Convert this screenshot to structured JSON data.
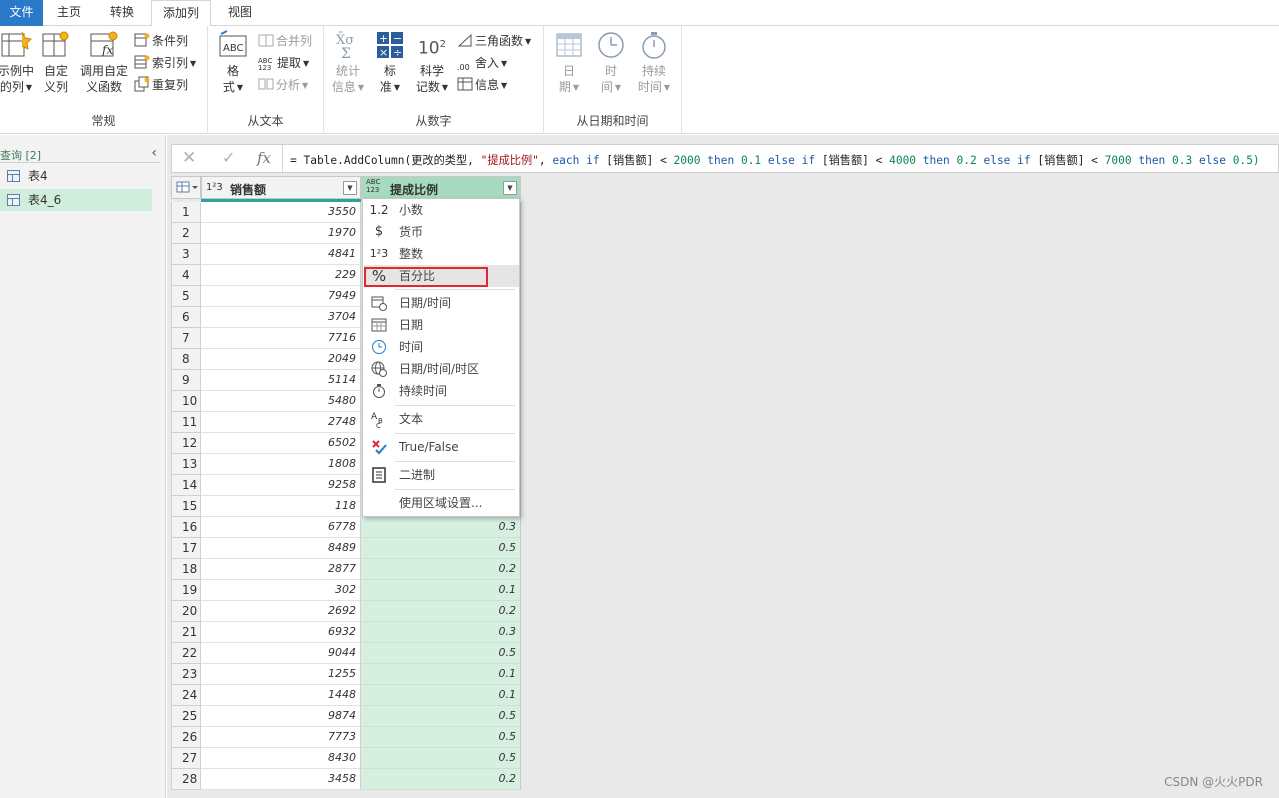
{
  "tabs": [
    {
      "label": "文件"
    },
    {
      "label": "主页"
    },
    {
      "label": "转换"
    },
    {
      "label": "添加列"
    },
    {
      "label": "视图"
    }
  ],
  "ribbon": {
    "general": {
      "label": "常规",
      "example_col_line1": "示例中",
      "example_col_line2": "的列",
      "custom_col_line1": "自定",
      "custom_col_line2": "义列",
      "invoke_func_line1": "调用自定",
      "invoke_func_line2": "义函数",
      "conditional_col": "条件列",
      "index_col": "索引列",
      "duplicate_col": "重复列"
    },
    "from_text": {
      "label": "从文本",
      "format_line1": "格",
      "format_line2": "式",
      "merge_cols": "合并列",
      "extract": "提取",
      "parse": "分析",
      "abc_icon_text": "ABC",
      "num_icon_text": "123"
    },
    "from_number": {
      "label": "从数字",
      "stats_line1": "统计",
      "stats_line2": "信息",
      "standard_line1": "标",
      "standard_line2": "准",
      "scientific_line1": "科学",
      "scientific_line2": "记数",
      "trig": "三角函数",
      "rounding": "舍入",
      "info": "信息",
      "ten_base": "10",
      "ten_exp": "2",
      "round_icon_text": ".00"
    },
    "from_date": {
      "label": "从日期和时间",
      "date_line1": "日",
      "date_line2": "期",
      "time_line1": "时",
      "time_line2": "间",
      "duration_line1": "持续",
      "duration_line2": "时间"
    }
  },
  "queries": {
    "header": "查询 [2]",
    "items": [
      {
        "label": "表4"
      },
      {
        "label": "表4_6"
      }
    ]
  },
  "formula_bar": {
    "formula_prefix": "= Table.AddColumn(更改的类型, ",
    "string_literal": "\"提成比例\"",
    "formula_body_1": ", ",
    "kw_each": "each",
    "kw_if1": "if",
    "cond1": " [销售额] < ",
    "num1": "2000",
    "kw_then1": "then",
    "val1": "0.1",
    "kw_else1": "else",
    "kw_if2": "if",
    "cond2": " [销售额] < ",
    "num2": "4000",
    "kw_then2": "then",
    "val2": "0.2",
    "kw_else2": "else",
    "kw_if3": "if",
    "cond3": " [销售额] < ",
    "num3": "7000",
    "kw_then3": "then",
    "val3": "0.3",
    "kw_else3": "else",
    "val4": "0.5)"
  },
  "grid": {
    "col1_header": "销售额",
    "col1_type": "1²3",
    "col2_header": "提成比例",
    "col2_type_top": "ABC",
    "col2_type_bottom": "123",
    "rows": [
      {
        "n": "1",
        "sales": "3550",
        "rate": ""
      },
      {
        "n": "2",
        "sales": "1970",
        "rate": ""
      },
      {
        "n": "3",
        "sales": "4841",
        "rate": ""
      },
      {
        "n": "4",
        "sales": "229",
        "rate": ""
      },
      {
        "n": "5",
        "sales": "7949",
        "rate": ""
      },
      {
        "n": "6",
        "sales": "3704",
        "rate": ""
      },
      {
        "n": "7",
        "sales": "7716",
        "rate": ""
      },
      {
        "n": "8",
        "sales": "2049",
        "rate": ""
      },
      {
        "n": "9",
        "sales": "5114",
        "rate": ""
      },
      {
        "n": "10",
        "sales": "5480",
        "rate": ""
      },
      {
        "n": "11",
        "sales": "2748",
        "rate": ""
      },
      {
        "n": "12",
        "sales": "6502",
        "rate": ""
      },
      {
        "n": "13",
        "sales": "1808",
        "rate": ""
      },
      {
        "n": "14",
        "sales": "9258",
        "rate": ""
      },
      {
        "n": "15",
        "sales": "118",
        "rate": ""
      },
      {
        "n": "16",
        "sales": "6778",
        "rate": "0.3"
      },
      {
        "n": "17",
        "sales": "8489",
        "rate": "0.5"
      },
      {
        "n": "18",
        "sales": "2877",
        "rate": "0.2"
      },
      {
        "n": "19",
        "sales": "302",
        "rate": "0.1"
      },
      {
        "n": "20",
        "sales": "2692",
        "rate": "0.2"
      },
      {
        "n": "21",
        "sales": "6932",
        "rate": "0.3"
      },
      {
        "n": "22",
        "sales": "9044",
        "rate": "0.5"
      },
      {
        "n": "23",
        "sales": "1255",
        "rate": "0.1"
      },
      {
        "n": "24",
        "sales": "1448",
        "rate": "0.1"
      },
      {
        "n": "25",
        "sales": "9874",
        "rate": "0.5"
      },
      {
        "n": "26",
        "sales": "7773",
        "rate": "0.5"
      },
      {
        "n": "27",
        "sales": "8430",
        "rate": "0.5"
      },
      {
        "n": "28",
        "sales": "3458",
        "rate": "0.2"
      }
    ]
  },
  "type_menu": {
    "items": [
      {
        "label": "小数",
        "icon": "1.2",
        "icon_name": "decimal-icon"
      },
      {
        "label": "货币",
        "icon": "$",
        "icon_name": "currency-icon"
      },
      {
        "label": "整数",
        "icon": "1²3",
        "icon_name": "integer-icon"
      },
      {
        "label": "百分比",
        "icon": "%",
        "icon_name": "percent-icon"
      },
      {
        "label": "日期/时间",
        "icon": "",
        "icon_name": "datetime-icon"
      },
      {
        "label": "日期",
        "icon": "",
        "icon_name": "date-icon"
      },
      {
        "label": "时间",
        "icon": "",
        "icon_name": "time-icon"
      },
      {
        "label": "日期/时间/时区",
        "icon": "",
        "icon_name": "datetimezone-icon"
      },
      {
        "label": "持续时间",
        "icon": "",
        "icon_name": "duration-icon"
      },
      {
        "label": "文本",
        "icon": "",
        "icon_name": "text-icon"
      },
      {
        "label": "True/False",
        "icon": "",
        "icon_name": "truefalse-icon"
      },
      {
        "label": "二进制",
        "icon": "",
        "icon_name": "binary-icon"
      },
      {
        "label": "使用区域设置...",
        "icon": "",
        "icon_name": ""
      }
    ]
  },
  "watermark": "CSDN @火火PDR",
  "colors": {
    "file_tab": "#2b79c9",
    "selected_column_header": "#a6dbbf",
    "selected_column_cell": "#d6efe1",
    "highlight_box": "#e0282e",
    "teal_bar": "#2aa59a"
  }
}
